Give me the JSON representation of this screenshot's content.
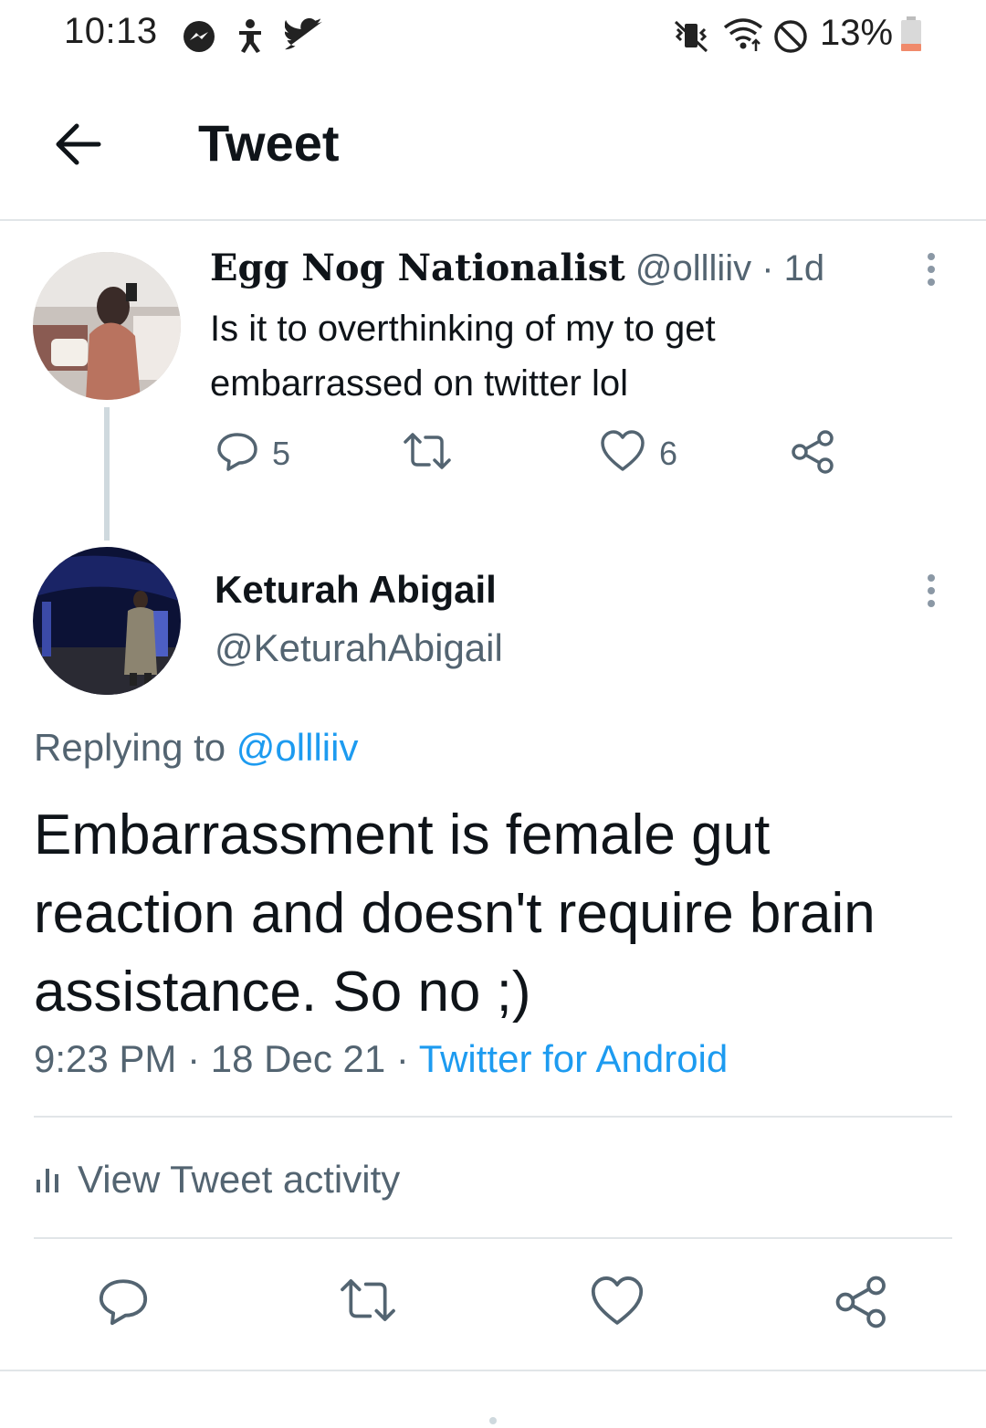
{
  "status_bar": {
    "time": "10:13",
    "battery": "13%",
    "icons": [
      "messenger-icon",
      "accessibility-icon",
      "twitter-icon",
      "vibrate-icon",
      "wifi-icon",
      "dnd-icon",
      "battery-icon"
    ]
  },
  "header": {
    "title": "Tweet"
  },
  "parent_tweet": {
    "name": "Egg Nog Nationalist",
    "meta": "@ollliiv · 1d",
    "text": "Is it to overthinking of my to get embarrassed on twitter lol",
    "replies": "5",
    "likes": "6"
  },
  "main_tweet": {
    "name": "Keturah Abigail",
    "handle": "@KeturahAbigail",
    "replying_prefix": "Replying to",
    "replying_handle": "@ollliiv",
    "text": "Embarrassment is female gut reaction and doesn't require brain assistance. So no ;)",
    "time_date": "9:23 PM · 18 Dec 21 · ",
    "source": "Twitter for Android",
    "activity_label": "View Tweet activity"
  },
  "colors": {
    "link": "#1d9bf0",
    "muted": "#536471",
    "text": "#0f1419",
    "divider": "#e1e5e8"
  }
}
